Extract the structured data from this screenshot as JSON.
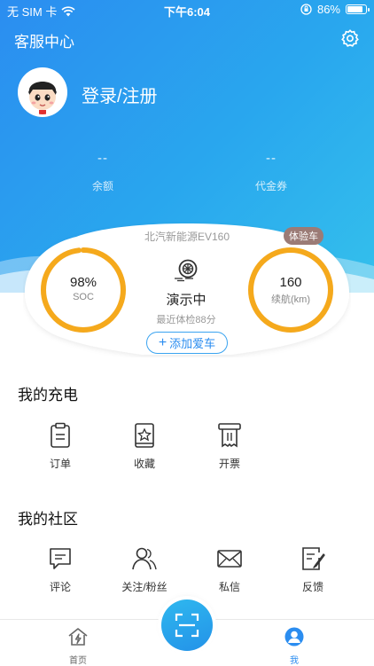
{
  "status_bar": {
    "carrier": "无 SIM 卡",
    "time": "下午6:04",
    "battery": "86%",
    "battery_level": 0.86
  },
  "nav": {
    "title": "客服中心",
    "settings_icon": "gear-icon"
  },
  "profile": {
    "login_label": "登录/注册",
    "avatar_icon": "cartoon-avatar"
  },
  "stats": [
    {
      "value": "--",
      "label": "余额"
    },
    {
      "value": "--",
      "label": "代金券"
    }
  ],
  "car": {
    "model": "北汽新能源EV160",
    "badge": "体验车",
    "soc_value": "98%",
    "soc_label": "SOC",
    "soc_level": 0.98,
    "range_value": "160",
    "range_label": "续航(km)",
    "range_level": 1.0,
    "status_title": "演示中",
    "status_sub": "最近体检88分",
    "add_car_label": "添加爱车",
    "gauge_color": "#f5a91c"
  },
  "charging": {
    "title": "我的充电",
    "items": [
      {
        "label": "订单",
        "icon": "clipboard-icon"
      },
      {
        "label": "收藏",
        "icon": "star-bookmark-icon"
      },
      {
        "label": "开票",
        "icon": "receipt-icon"
      }
    ]
  },
  "community": {
    "title": "我的社区",
    "items": [
      {
        "label": "评论",
        "icon": "comment-icon"
      },
      {
        "label": "关注/粉丝",
        "icon": "users-icon"
      },
      {
        "label": "私信",
        "icon": "mail-icon"
      },
      {
        "label": "反馈",
        "icon": "feedback-icon"
      }
    ]
  },
  "tab_bar": {
    "home_label": "首页",
    "me_label": "我",
    "active_color": "#2b8df0",
    "inactive_color": "#666666"
  },
  "colors": {
    "brand": "#2b8df0",
    "accent_orange": "#f5a91c"
  }
}
